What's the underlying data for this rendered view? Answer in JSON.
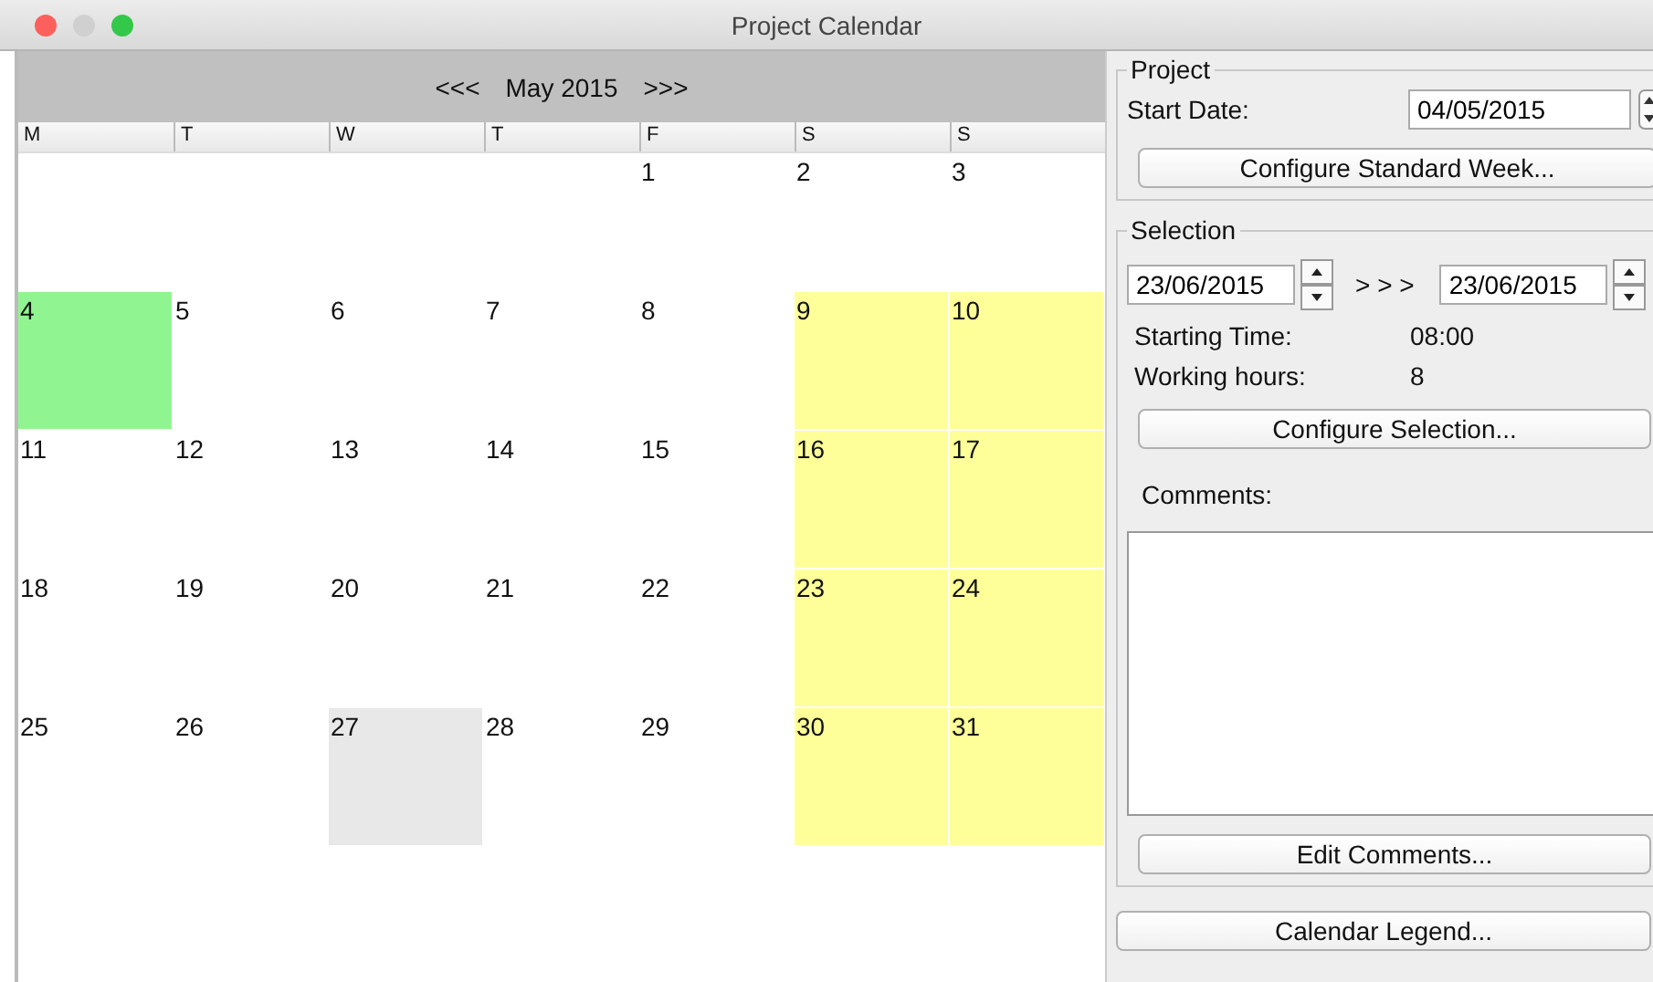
{
  "window": {
    "title": "Project Calendar"
  },
  "calendar": {
    "prev": "<<<",
    "month": "May 2015",
    "next": ">>>",
    "weekdays": [
      "M",
      "T",
      "W",
      "T",
      "F",
      "S",
      "S"
    ],
    "days": [
      {
        "kind": "blank"
      },
      {
        "kind": "blank"
      },
      {
        "kind": "blank"
      },
      {
        "kind": "blank"
      },
      {
        "kind": "day",
        "label": "1"
      },
      {
        "kind": "day",
        "label": "2"
      },
      {
        "kind": "day",
        "label": "3"
      },
      {
        "kind": "day",
        "label": "4",
        "color": "#90f590"
      },
      {
        "kind": "day",
        "label": "5"
      },
      {
        "kind": "day",
        "label": "6"
      },
      {
        "kind": "day",
        "label": "7"
      },
      {
        "kind": "day",
        "label": "8"
      },
      {
        "kind": "day",
        "label": "9",
        "color": "#ffff99"
      },
      {
        "kind": "day",
        "label": "10",
        "color": "#ffff99"
      },
      {
        "kind": "day",
        "label": "11"
      },
      {
        "kind": "day",
        "label": "12"
      },
      {
        "kind": "day",
        "label": "13"
      },
      {
        "kind": "day",
        "label": "14"
      },
      {
        "kind": "day",
        "label": "15"
      },
      {
        "kind": "day",
        "label": "16",
        "color": "#ffff99"
      },
      {
        "kind": "day",
        "label": "17",
        "color": "#ffff99"
      },
      {
        "kind": "day",
        "label": "18"
      },
      {
        "kind": "day",
        "label": "19"
      },
      {
        "kind": "day",
        "label": "20"
      },
      {
        "kind": "day",
        "label": "21"
      },
      {
        "kind": "day",
        "label": "22"
      },
      {
        "kind": "day",
        "label": "23",
        "color": "#ffff99"
      },
      {
        "kind": "day",
        "label": "24",
        "color": "#ffff99"
      },
      {
        "kind": "day",
        "label": "25"
      },
      {
        "kind": "day",
        "label": "26"
      },
      {
        "kind": "day",
        "label": "27",
        "color": "#e8e8e8"
      },
      {
        "kind": "day",
        "label": "28"
      },
      {
        "kind": "day",
        "label": "29"
      },
      {
        "kind": "day",
        "label": "30",
        "color": "#ffff99"
      },
      {
        "kind": "day",
        "label": "31",
        "color": "#ffff99"
      }
    ]
  },
  "project": {
    "title": "Project",
    "start_date_label": "Start Date:",
    "start_date": "04/05/2015",
    "button": "Configure Standard Week..."
  },
  "selection": {
    "title": "Selection",
    "from": "23/06/2015",
    "separator": "> > >",
    "to": "23/06/2015",
    "fields": [
      {
        "label": "Starting Time:",
        "value": "08:00"
      },
      {
        "label": "Working hours:",
        "value": "8"
      }
    ],
    "configure_button": "Configure Selection...",
    "comments_label": "Comments:",
    "edit_button": "Edit Comments..."
  },
  "legend_button": "Calendar Legend..."
}
